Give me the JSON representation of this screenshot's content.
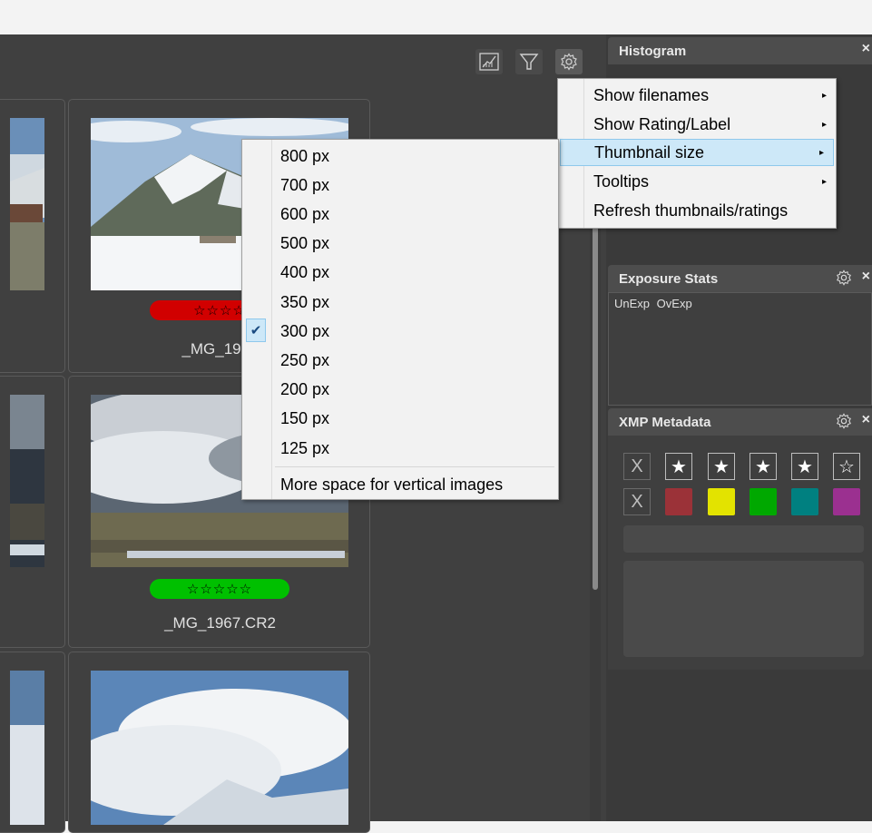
{
  "toolbar": {
    "buttons": [
      {
        "icon": "chart-icon"
      },
      {
        "icon": "filter-icon"
      },
      {
        "icon": "gear-icon"
      }
    ]
  },
  "thumbnails": [
    {
      "filename": "_MG_1953",
      "rating_color": "#d10000",
      "stars": "☆☆☆☆"
    },
    {
      "filename": "_MG_1967.CR2",
      "rating_color": "#00c000",
      "stars": "☆☆☆☆☆"
    }
  ],
  "panels": {
    "histogram": {
      "title": "Histogram",
      "close": "×"
    },
    "exposure": {
      "title": "Exposure Stats",
      "close": "×",
      "col1": "UnExp",
      "col2": "OvExp"
    },
    "xmp": {
      "title": "XMP Metadata",
      "close": "×",
      "reject_label": "X",
      "stars": [
        "★",
        "★",
        "★",
        "★",
        "☆"
      ],
      "clear_label": "X",
      "label_colors": [
        "#9b3238",
        "#e3e300",
        "#00a800",
        "#008080",
        "#9b3090"
      ]
    }
  },
  "context_menu": {
    "items": [
      {
        "label": "Show filenames",
        "submenu": "▸"
      },
      {
        "label": "Show Rating/Label",
        "submenu": "▸"
      },
      {
        "label": "Thumbnail size",
        "submenu": "▸",
        "highlighted": true
      },
      {
        "label": "Tooltips",
        "submenu": "▸"
      },
      {
        "label": "Refresh thumbnails/ratings"
      }
    ]
  },
  "size_submenu": {
    "items": [
      "800 px",
      "700 px",
      "600 px",
      "500 px",
      "400 px",
      "350 px",
      "300 px",
      "250 px",
      "200 px",
      "150 px",
      "125 px"
    ],
    "selected": "300 px",
    "check": "✔",
    "extra": "More space for vertical images"
  }
}
